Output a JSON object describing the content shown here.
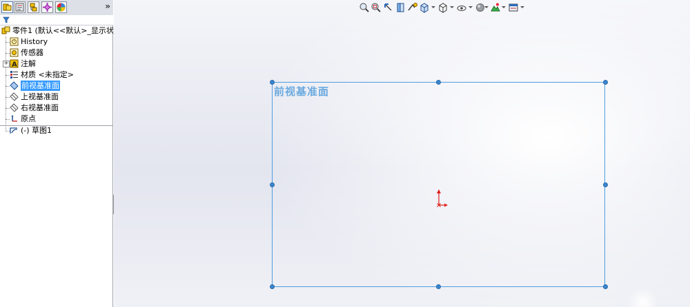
{
  "panel": {
    "tabs": [
      "feature-manager",
      "property-manager",
      "configuration-manager",
      "dimxpert-manager",
      "display-manager"
    ],
    "more_tabs": "»"
  },
  "tree": {
    "root": "零件1  (默认<<默认>_显示状态",
    "items": [
      {
        "label": "History",
        "icon": "history-icon"
      },
      {
        "label": "传感器",
        "icon": "sensor-icon"
      },
      {
        "label": "注解",
        "icon": "annotation-icon",
        "expand": "+"
      },
      {
        "label": "材质 <未指定>",
        "icon": "material-icon"
      },
      {
        "label": "前视基准面",
        "icon": "plane-icon",
        "selected": true
      },
      {
        "label": "上视基准面",
        "icon": "plane-icon"
      },
      {
        "label": "右视基准面",
        "icon": "plane-icon"
      },
      {
        "label": "原点",
        "icon": "origin-icon"
      },
      {
        "label": "(-) 草图1",
        "icon": "sketch-icon"
      }
    ]
  },
  "viewport": {
    "plane_label": "前视基准面",
    "colors": {
      "plane_border": "#4d9de0",
      "plane_label": "#6aa9df",
      "origin": "#e0201c",
      "selection": "#3399ff"
    }
  },
  "heads_up_toolbar": [
    "zoom-to-fit-icon",
    "zoom-area-icon",
    "previous-view-icon",
    "section-view-icon",
    "dynamic-annotation-icon",
    "view-orientation-icon",
    "display-style-icon",
    "hide-show-icon",
    "edit-appearance-icon",
    "apply-scene-icon",
    "view-settings-icon"
  ]
}
